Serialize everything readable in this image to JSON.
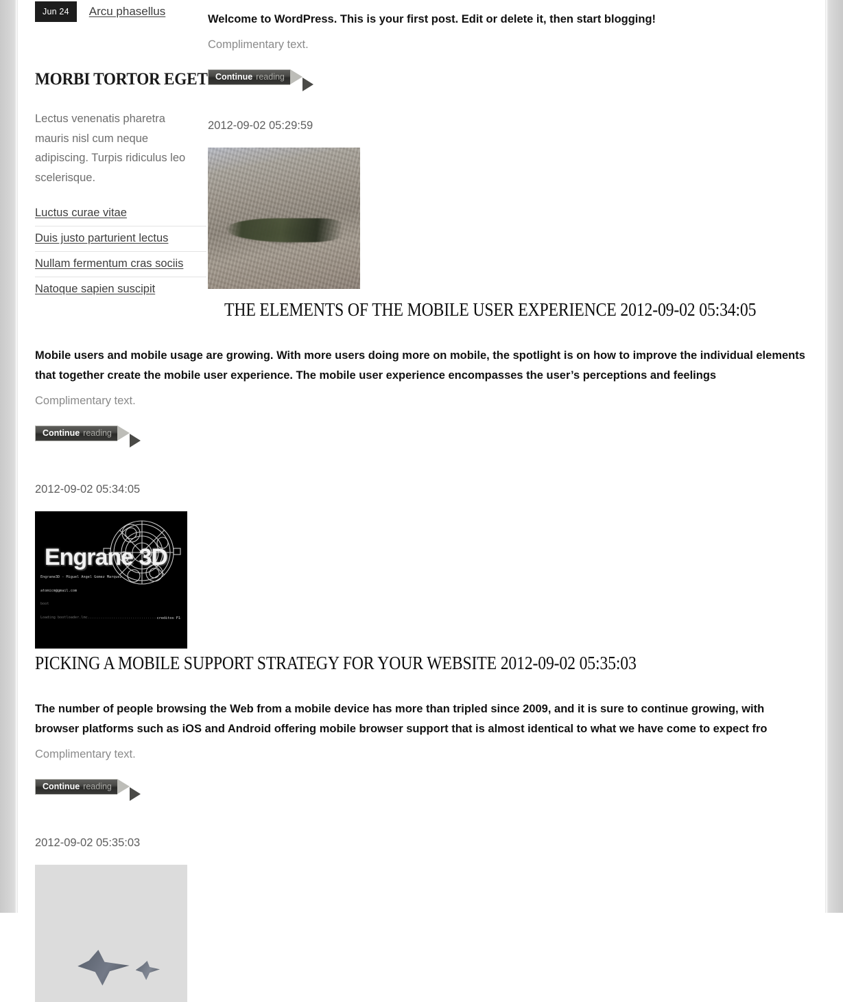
{
  "sidebar": {
    "date_badge": "Jun 24",
    "top_link": "Arcu phasellus",
    "widget_title": "MORBI TORTOR EGET",
    "widget_body": "Lectus venenatis pharetra mauris nisl cum neque adipiscing. Turpis ridiculus leo scelerisque.",
    "links": [
      "Luctus curae vitae",
      "Duis justo parturient lectus",
      "Nullam fermentum cras sociis",
      "Natoque sapien suscipit"
    ]
  },
  "colors": {
    "badge_bg": "#1d1d1d",
    "badge_text": "#ffffff",
    "muted_text": "#8a8a8a",
    "link_text": "#3d3d3d",
    "body_text": "#111111",
    "page_bg": "#ffffff",
    "gutter": "#c9c9c9",
    "button_dark": "#3a3a38",
    "button_arrow": "#bdbdb8"
  },
  "button": {
    "strong": "Continue",
    "light": "reading",
    "icon": "arrow-right-chevron"
  },
  "posts": [
    {
      "excerpt": "Welcome to WordPress. This is your first post. Edit or delete it, then start blogging!",
      "complimentary": "Complimentary text.",
      "date": "",
      "title": "",
      "thumb_name": ""
    },
    {
      "date": "2012-09-02 05:29:59",
      "thumb_name": "jet-over-terrain-thumbnail",
      "title": "THE ELEMENTS OF THE MOBILE USER EXPERIENCE 2012-09-02 05:34:05",
      "excerpt": "Mobile users and mobile usage are growing. With more users doing more on mobile, the spotlight is on how to improve the individual elements that together create the mobile user experience. The mobile user experience encompasses the user’s perceptions and feelings",
      "complimentary": "Complimentary text."
    },
    {
      "date": "2012-09-02 05:34:05",
      "thumb_name": "engrane-3d-splash-thumbnail",
      "title": "PICKING A MOBILE SUPPORT STRATEGY FOR YOUR WEBSITE 2012-09-02 05:35:03",
      "excerpt": "The number of people browsing the Web from a mobile device has more than tripled since 2009, and it is sure to continue growing, with browser platforms such as iOS and Android offering mobile browser support that is almost identical to what we have come to expect fro",
      "complimentary": "Complimentary text."
    },
    {
      "date": "2012-09-02 05:35:03",
      "thumb_name": "jets-in-sky-thumbnail",
      "title": "",
      "excerpt": "",
      "complimentary": ""
    }
  ],
  "engrane_thumb": {
    "logo": "Engrane 3D",
    "console_line1": "Engrane3D - Miguel Angel Gomez Marquez.",
    "console_line2": "atomicm@gmail.com",
    "console_line3": "boot",
    "console_line4": "Loading bootloader.lmc............................................",
    "credits": "creditos F1"
  }
}
